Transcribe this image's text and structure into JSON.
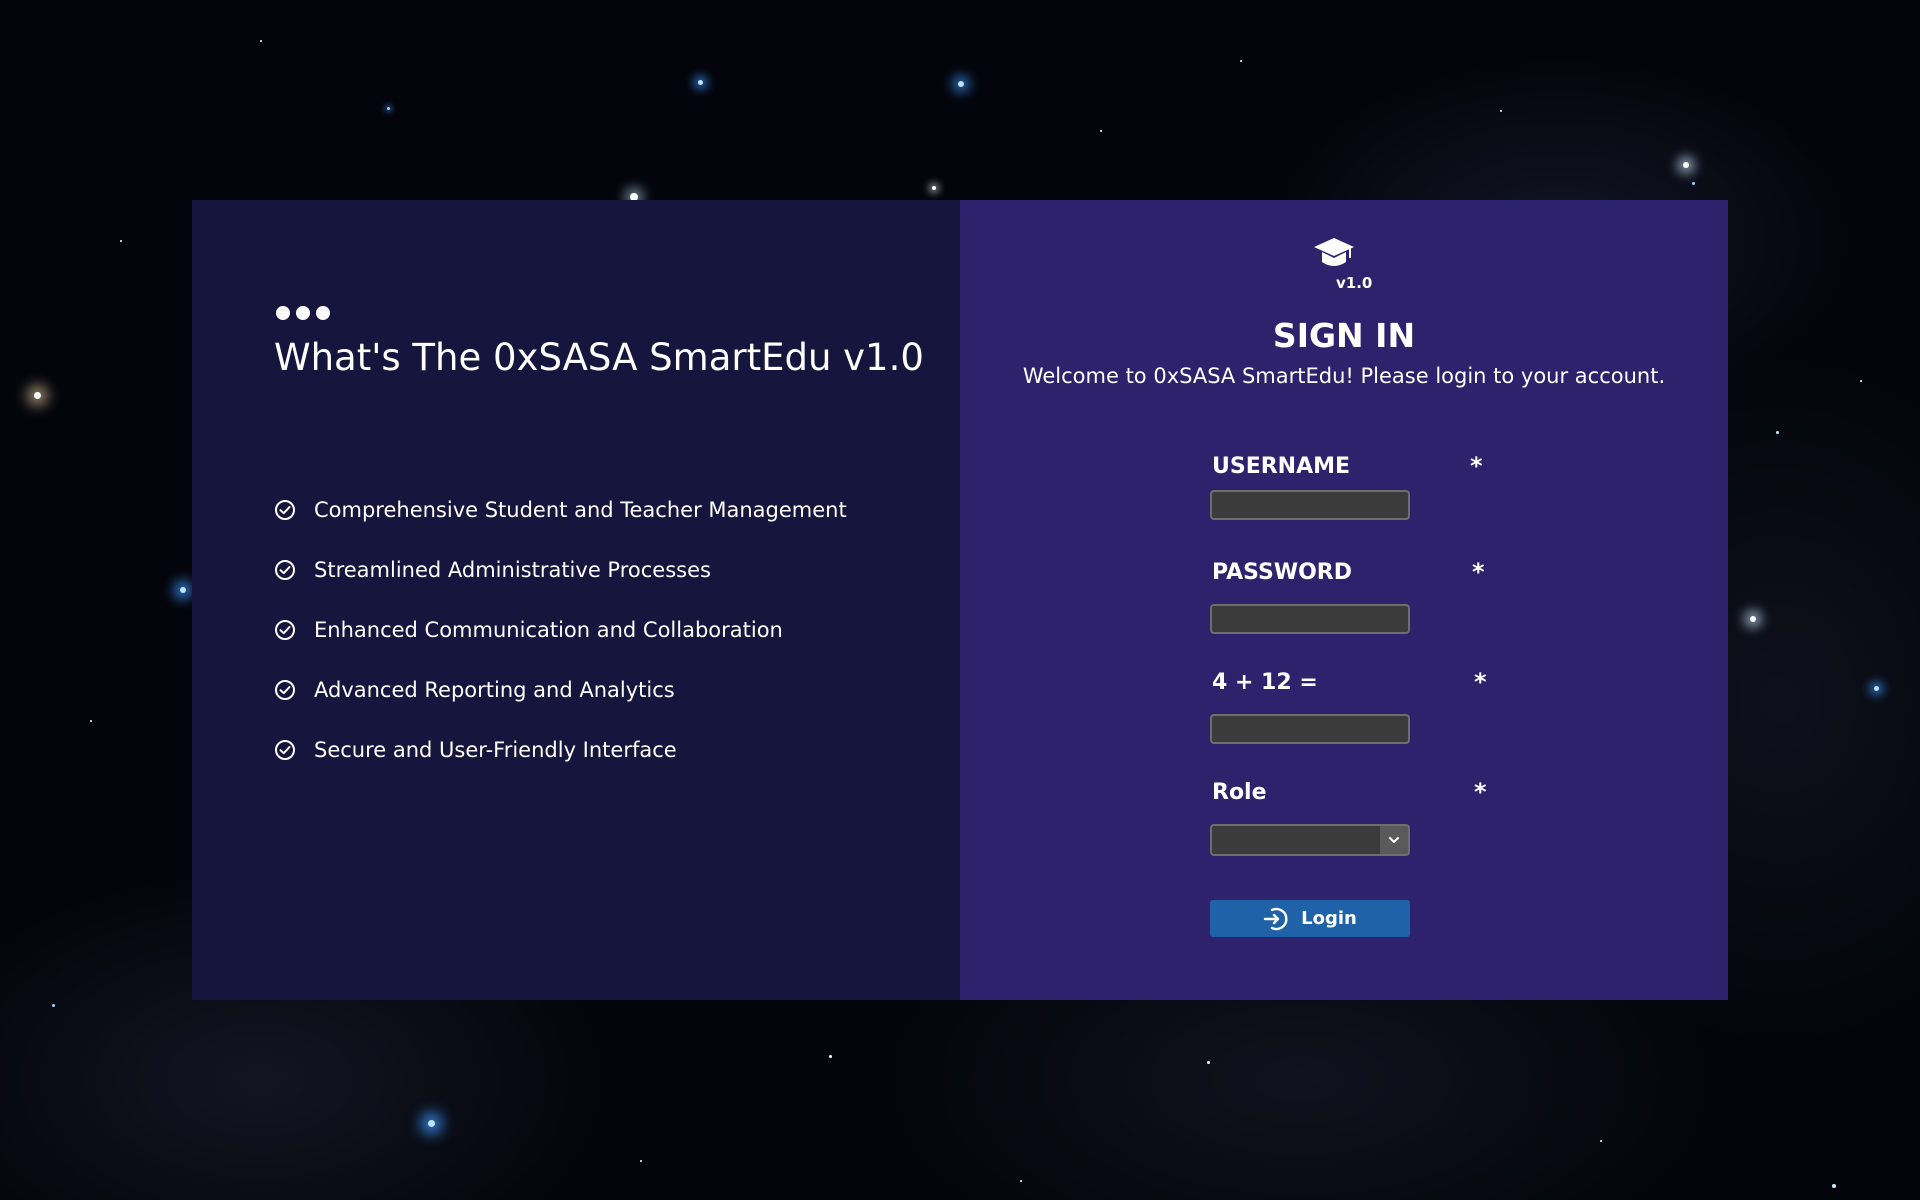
{
  "info_panel": {
    "headline": "What's The 0xSASA SmartEdu v1.0",
    "features": [
      "Comprehensive Student and Teacher Management",
      "Streamlined Administrative Processes",
      "Enhanced Communication and Collaboration",
      "Advanced Reporting and Analytics",
      "Secure and User-Friendly Interface"
    ]
  },
  "login_panel": {
    "logo_icon": "graduation-cap-icon",
    "version": "v1.0",
    "title": "SIGN IN",
    "subtitle": "Welcome to 0xSASA SmartEdu! Please login to your account.",
    "fields": {
      "username": {
        "label": "USERNAME",
        "required_mark": "*",
        "value": ""
      },
      "password": {
        "label": "PASSWORD",
        "required_mark": "*",
        "value": ""
      },
      "captcha": {
        "label": "4 + 12 =",
        "required_mark": "*",
        "value": ""
      },
      "role": {
        "label": "Role",
        "required_mark": "*",
        "selected": ""
      }
    },
    "login_button": {
      "label": "Login",
      "icon": "sign-in-icon"
    }
  },
  "colors": {
    "left_panel": "#16153d",
    "right_panel": "#2e226c",
    "button": "#1f62a8",
    "input": "#3b3b3b"
  }
}
